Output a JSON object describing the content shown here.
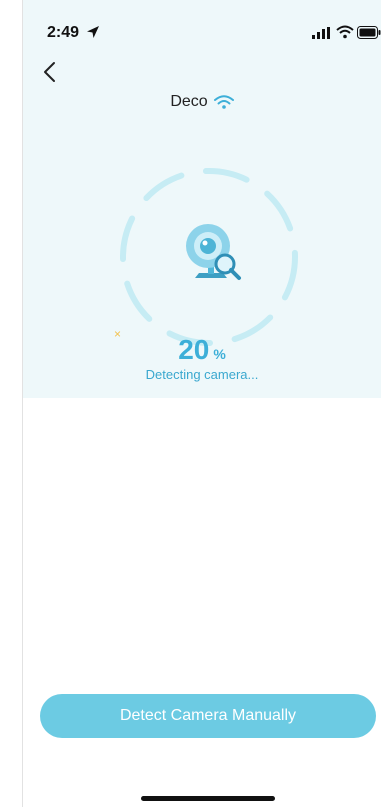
{
  "status_bar": {
    "time": "2:49"
  },
  "header": {
    "title": "Deco"
  },
  "scan": {
    "progress_value": "20",
    "progress_unit": "%",
    "status": "Detecting camera...",
    "progress_fraction": 0.2
  },
  "actions": {
    "detect_manual_label": "Detect Camera Manually"
  },
  "colors": {
    "accent": "#3dafd8",
    "button": "#6ccbe3",
    "panel_bg": "#eef8fa",
    "ring": "#c6ecf4"
  },
  "icons": [
    "location-arrow-icon",
    "cellular-signal-icon",
    "wifi-icon",
    "battery-icon",
    "back-chevron-icon",
    "webcam-search-icon",
    "sparkle-icon"
  ]
}
